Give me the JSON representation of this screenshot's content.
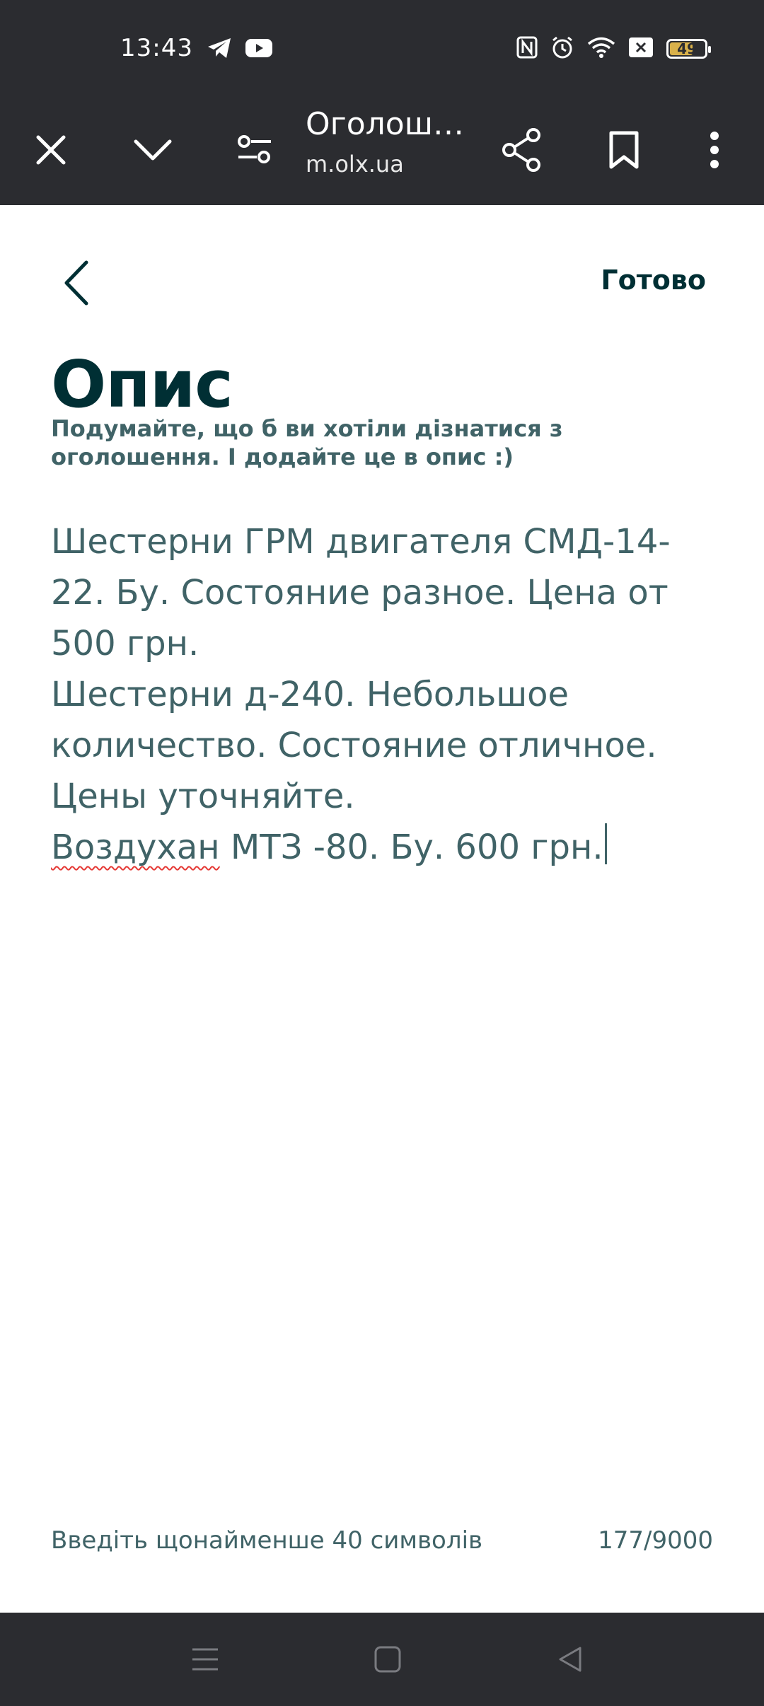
{
  "status_bar": {
    "time": "13:43",
    "battery_level": "49",
    "icons": [
      "telegram-icon",
      "youtube-icon",
      "nfc-icon",
      "alarm-icon",
      "wifi-icon",
      "sim-off-icon",
      "battery-icon"
    ]
  },
  "browser": {
    "title": "Оголоше...",
    "url": "m.olx.ua",
    "icons": [
      "close-icon",
      "chevron-down-icon",
      "site-settings-icon",
      "share-icon",
      "bookmark-icon",
      "more-icon"
    ]
  },
  "header": {
    "done_label": "Готово"
  },
  "page": {
    "title": "Опис",
    "subtitle": "Подумайте, що б ви хотіли дізнатися з оголошення. І додайте це в опис :)",
    "description_lines": [
      "Шестерни ГРМ двигателя СМД-14-22. Бу. Состояние разное. Цена от 500 грн.",
      "Шестерни д-240. Небольшое количество. Состояние отличное. Цены уточняйте."
    ],
    "last_line_misspelled": "Воздухан",
    "last_line_rest": " МТЗ -80. Бу. 600 грн.",
    "hint": "Введіть щонайменше 40 символів",
    "counter": "177/9000"
  },
  "colors": {
    "heading": "#002f34",
    "text": "#406367",
    "system_bar": "#2b2c30",
    "spell_underline": "#e53935"
  }
}
